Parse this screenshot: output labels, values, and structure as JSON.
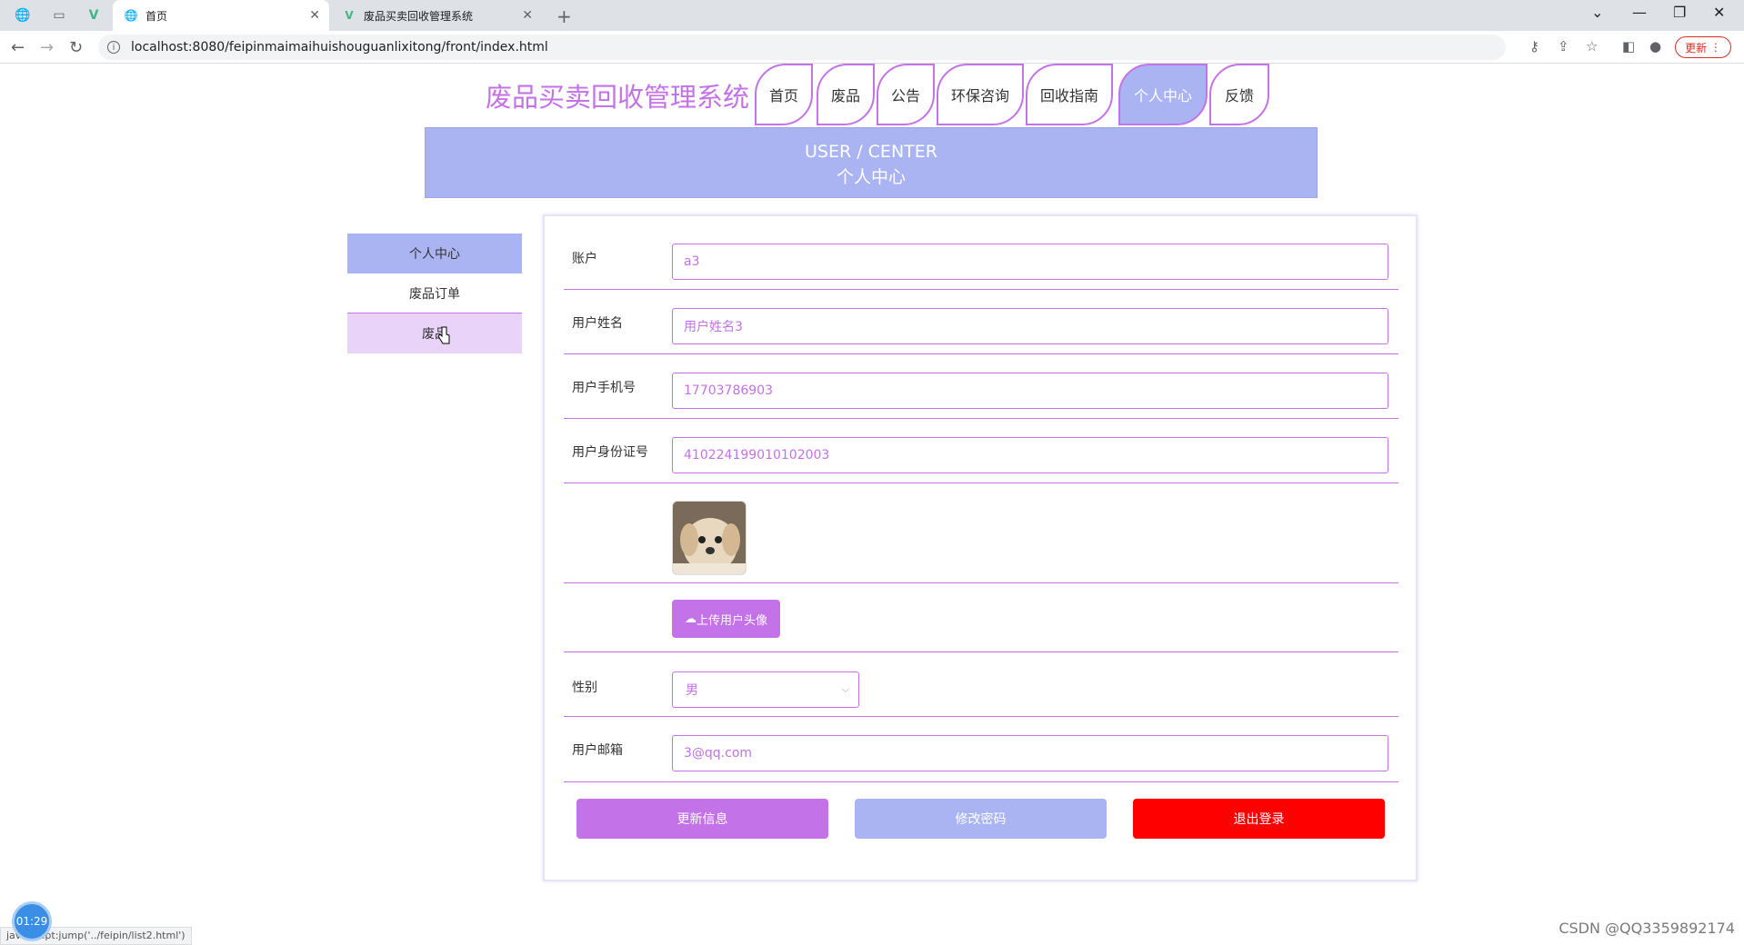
{
  "browser": {
    "tabs": [
      {
        "label": "首页",
        "active": true
      },
      {
        "label": "废品买卖回收管理系统",
        "active": false
      }
    ],
    "url": "localhost:8080/feipinmaimaihuishouguanlixitong/front/index.html",
    "update_label": "更新"
  },
  "site": {
    "title": "废品买卖回收管理系统",
    "nav": [
      "首页",
      "废品",
      "公告",
      "环保咨询",
      "回收指南",
      "个人中心",
      "反馈"
    ],
    "active_nav": "个人中心"
  },
  "banner": {
    "line1": "USER / CENTER",
    "line2": "个人中心"
  },
  "sidebar": {
    "items": [
      "个人中心",
      "废品订单",
      "废品"
    ]
  },
  "form": {
    "account_label": "账户",
    "account_value": "a3",
    "name_label": "用户姓名",
    "name_value": "用户姓名3",
    "phone_label": "用户手机号",
    "phone_value": "17703786903",
    "idcard_label": "用户身份证号",
    "idcard_value": "410224199010102003",
    "upload_label": "上传用户头像",
    "gender_label": "性别",
    "gender_value": "男",
    "email_label": "用户邮箱",
    "email_value": "3@qq.com"
  },
  "actions": {
    "update": "更新信息",
    "change_password": "修改密码",
    "logout": "退出登录"
  },
  "colors": {
    "accent": "#c472e8",
    "banner": "#aab4f3",
    "logout": "#ff0000"
  },
  "overlay": {
    "timer": "01:29",
    "status_url": "javascript:jump('../feipin/list2.html')",
    "watermark": "CSDN @QQ3359892174"
  }
}
